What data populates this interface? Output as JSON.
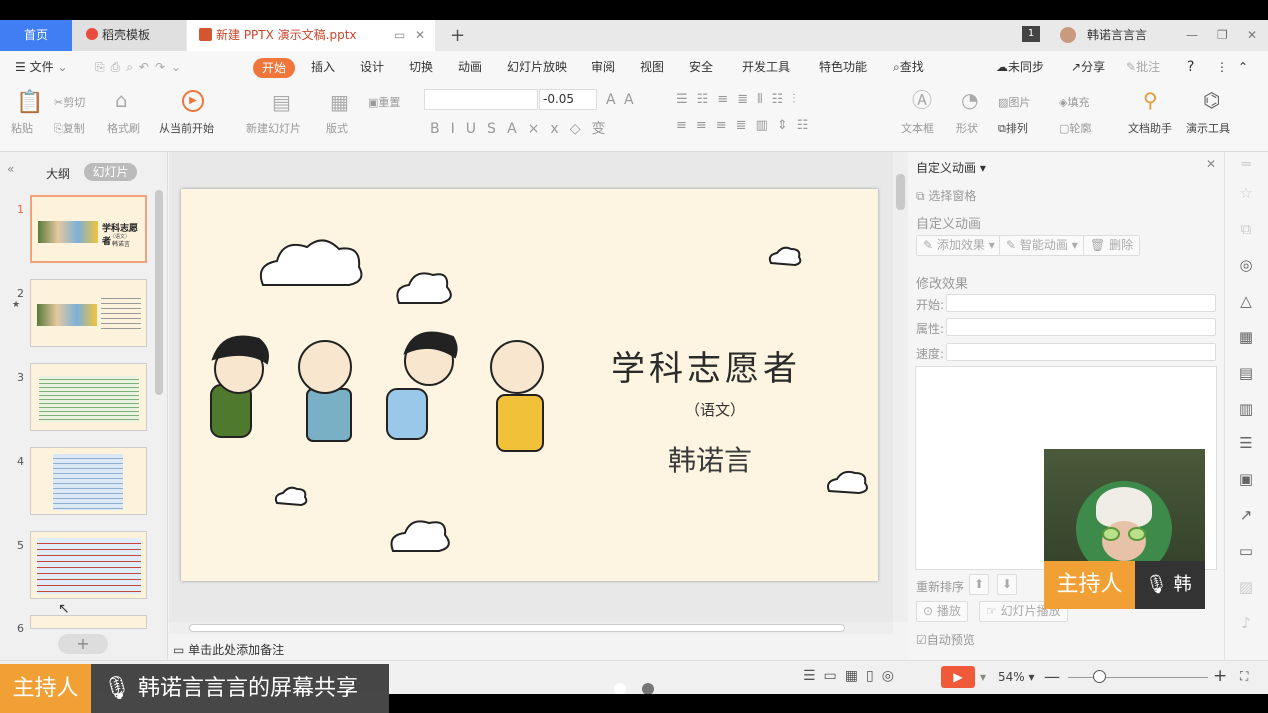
{
  "tabs": {
    "home": "首页",
    "daoke": "稻壳模板",
    "file": "新建 PPTX 演示文稿.pptx",
    "plus": "+"
  },
  "user": {
    "name": "韩诺言言言",
    "badge": "1"
  },
  "menu": {
    "file": "文件",
    "items": [
      "开始",
      "插入",
      "设计",
      "切换",
      "动画",
      "幻灯片放映",
      "审阅",
      "视图",
      "安全",
      "开发工具",
      "特色功能"
    ],
    "search": "查找",
    "sync": "未同步",
    "share": "分享",
    "comment": "批注"
  },
  "ribbon": {
    "paste": "粘贴",
    "cut": "剪切",
    "copy": "复制",
    "fmt": "格式刷",
    "from_current": "从当前开始",
    "new_slide": "新建幻灯片",
    "layout": "版式",
    "reset": "重置",
    "font_size": "-0.05",
    "textbox": "文本框",
    "shape": "形状",
    "picture": "图片",
    "fill": "填充",
    "arrange": "排列",
    "outline": "轮廓",
    "doc_helper": "文档助手",
    "present_tool": "演示工具"
  },
  "left": {
    "outline_tab": "大纲",
    "slides_tab": "幻灯片",
    "nums": [
      "1",
      "2",
      "3",
      "4",
      "5",
      "6"
    ]
  },
  "slide": {
    "title": "学科志愿者",
    "subtitle": "（语文）",
    "author": "韩诺言"
  },
  "thumb1": {
    "title": "学科志愿者",
    "sub": "（语文）",
    "author": "韩诺言"
  },
  "rpanel": {
    "header": "自定义动画",
    "pane": "选择窗格",
    "section1": "自定义动画",
    "add": "添加效果",
    "smart": "智能动画",
    "del": "删除",
    "section2": "修改效果",
    "start": "开始:",
    "prop": "属性:",
    "speed": "速度:",
    "reorder": "重新排序",
    "play": "播放",
    "slideshow": "幻灯片播放",
    "autopreview": "自动预览"
  },
  "notes": "单击此处添加备注",
  "status": {
    "zoom": "54%"
  },
  "overlay": {
    "host": "主持人",
    "host_name": "韩",
    "share_text": "韩诺言言言的屏幕共享"
  }
}
